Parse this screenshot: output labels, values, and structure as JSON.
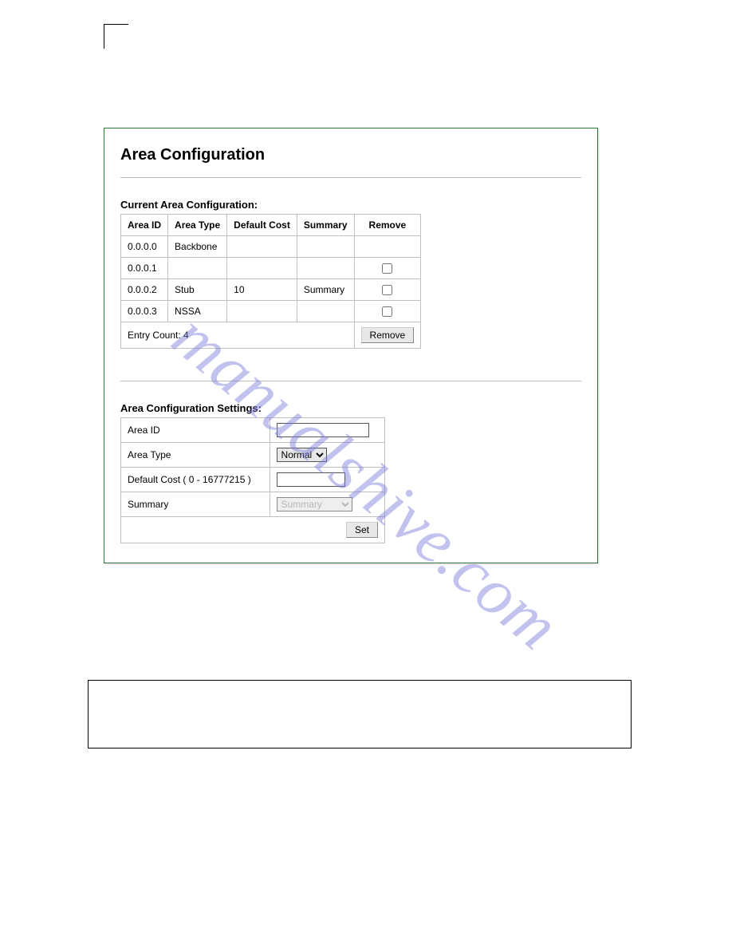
{
  "panel": {
    "title": "Area Configuration",
    "current": {
      "heading": "Current Area Configuration:",
      "headers": {
        "area_id": "Area ID",
        "area_type": "Area Type",
        "default_cost": "Default Cost",
        "summary": "Summary",
        "remove": "Remove"
      },
      "rows": [
        {
          "area_id": "0.0.0.0",
          "area_type": "Backbone",
          "default_cost": "",
          "summary": "",
          "has_checkbox": false
        },
        {
          "area_id": "0.0.0.1",
          "area_type": "",
          "default_cost": "",
          "summary": "",
          "has_checkbox": true
        },
        {
          "area_id": "0.0.0.2",
          "area_type": "Stub",
          "default_cost": "10",
          "summary": "Summary",
          "has_checkbox": true
        },
        {
          "area_id": "0.0.0.3",
          "area_type": "NSSA",
          "default_cost": "",
          "summary": "",
          "has_checkbox": true
        }
      ],
      "entry_count_label": "Entry Count: 4",
      "remove_btn": "Remove"
    },
    "settings": {
      "heading": "Area Configuration Settings:",
      "area_id_label": "Area ID",
      "area_type_label": "Area Type",
      "area_type_value": "Normal",
      "default_cost_label": "Default Cost ( 0 - 16777215 )",
      "summary_label": "Summary",
      "summary_value": "Summary",
      "set_btn": "Set"
    }
  },
  "watermark": "manualshive.com"
}
